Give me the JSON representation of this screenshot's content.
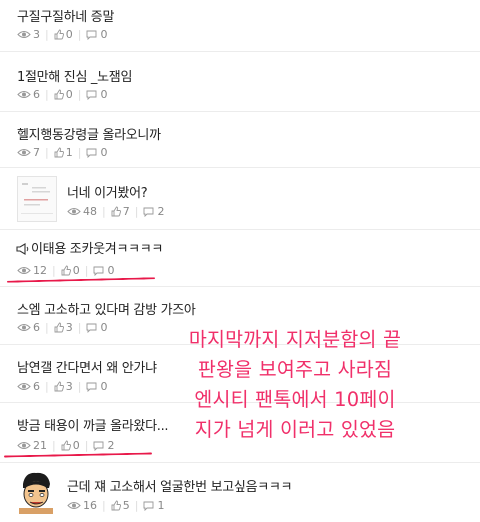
{
  "posts": [
    {
      "title": "구질구질하네 증말",
      "views": "3",
      "likes": "0",
      "comments": "0"
    },
    {
      "title": "1절만해 진심 _노잼임",
      "views": "6",
      "likes": "0",
      "comments": "0"
    },
    {
      "title": "헬지행동강령글 올라오니까",
      "views": "7",
      "likes": "1",
      "comments": "0"
    },
    {
      "title": "너네 이거봤어?",
      "views": "48",
      "likes": "7",
      "comments": "2"
    },
    {
      "title": "이태용 조카웃겨ㅋㅋㅋㅋ",
      "views": "12",
      "likes": "0",
      "comments": "0"
    },
    {
      "title": "스엠 고소하고 있다며 감방 가즈아",
      "views": "6",
      "likes": "3",
      "comments": "0"
    },
    {
      "title": "남연갤 간다면서 왜 안가냐",
      "views": "6",
      "likes": "3",
      "comments": "0"
    },
    {
      "title": "방금 태용이 까글 올라왔다...",
      "views": "21",
      "likes": "0",
      "comments": "2"
    },
    {
      "title": "근데 쟤 고소해서 얼굴한번 보고싶음ㅋㅋㅋ",
      "views": "16",
      "likes": "5",
      "comments": "1"
    }
  ],
  "annotation": "마지막까지 지저분함의 끝\n판왕을 보여주고 사라짐\n엔시티 팬톡에서 10페이\n지가 넘게 이러고 있었음",
  "icons": {
    "views": "eye-icon",
    "likes": "thumbs-up-icon",
    "comments": "comment-icon",
    "announce": "megaphone-icon"
  },
  "colors": {
    "annotation": "#f0306a",
    "underline": "#e8194a",
    "meta": "#888888"
  }
}
